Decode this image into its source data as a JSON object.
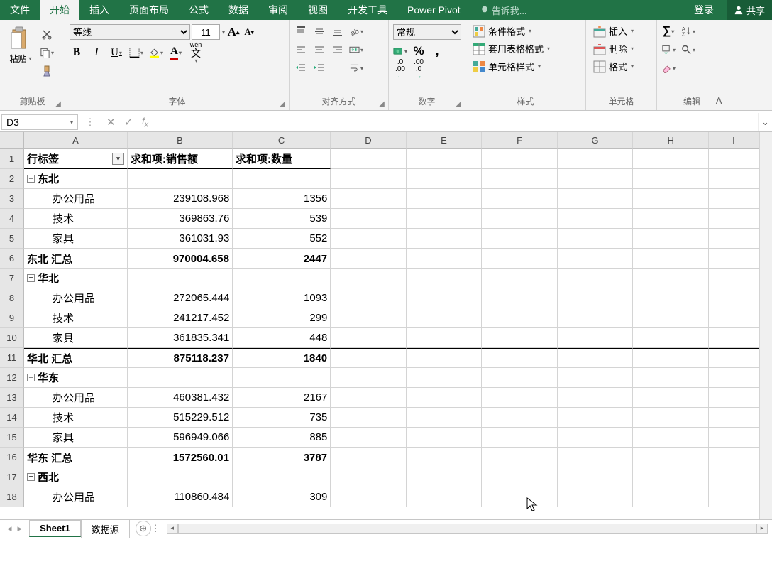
{
  "menu": {
    "file": "文件",
    "home": "开始",
    "insert": "插入",
    "layout": "页面布局",
    "formulas": "公式",
    "data": "数据",
    "review": "审阅",
    "view": "视图",
    "dev": "开发工具",
    "pivot": "Power Pivot",
    "tellme": "告诉我...",
    "login": "登录",
    "share": "共享"
  },
  "ribbon": {
    "clipboard": {
      "paste": "粘贴",
      "label": "剪贴板"
    },
    "font": {
      "name": "等线",
      "size": "11",
      "bold": "B",
      "italic": "I",
      "underline": "U",
      "label": "字体",
      "wen": "wén",
      "wenchar": "文"
    },
    "align": {
      "label": "对齐方式"
    },
    "number": {
      "format": "常规",
      "pct": "%",
      "comma": ",",
      "dec_inc": ".0 .00",
      "label": "数字"
    },
    "styles": {
      "cond": "条件格式",
      "table": "套用表格格式",
      "cell": "单元格样式",
      "label": "样式"
    },
    "cells": {
      "insert": "插入",
      "delete": "删除",
      "format": "格式",
      "label": "单元格"
    },
    "editing": {
      "label": "编辑"
    }
  },
  "fx": {
    "cell_ref": "D3",
    "formula": ""
  },
  "grid": {
    "col_widths": {
      "A": 148,
      "B": 150,
      "C": 140,
      "D": 108,
      "E": 108,
      "F": 108,
      "G": 108,
      "H": 108,
      "I": 72
    },
    "cols": [
      "A",
      "B",
      "C",
      "D",
      "E",
      "F",
      "G",
      "H",
      "I"
    ],
    "row_count": 18,
    "header": [
      "行标签",
      "求和项:销售额",
      "求和项:数量"
    ],
    "rows": [
      {
        "type": "group",
        "a": "东北"
      },
      {
        "type": "item",
        "a": "办公用品",
        "b": "239108.968",
        "c": "1356"
      },
      {
        "type": "item",
        "a": "技术",
        "b": "369863.76",
        "c": "539"
      },
      {
        "type": "item",
        "a": "家具",
        "b": "361031.93",
        "c": "552"
      },
      {
        "type": "total",
        "a": "东北 汇总",
        "b": "970004.658",
        "c": "2447"
      },
      {
        "type": "group",
        "a": "华北"
      },
      {
        "type": "item",
        "a": "办公用品",
        "b": "272065.444",
        "c": "1093"
      },
      {
        "type": "item",
        "a": "技术",
        "b": "241217.452",
        "c": "299"
      },
      {
        "type": "item",
        "a": "家具",
        "b": "361835.341",
        "c": "448"
      },
      {
        "type": "total",
        "a": "华北 汇总",
        "b": "875118.237",
        "c": "1840"
      },
      {
        "type": "group",
        "a": "华东"
      },
      {
        "type": "item",
        "a": "办公用品",
        "b": "460381.432",
        "c": "2167"
      },
      {
        "type": "item",
        "a": "技术",
        "b": "515229.512",
        "c": "735"
      },
      {
        "type": "item",
        "a": "家具",
        "b": "596949.066",
        "c": "885"
      },
      {
        "type": "total",
        "a": "华东 汇总",
        "b": "1572560.01",
        "c": "3787"
      },
      {
        "type": "group",
        "a": "西北"
      },
      {
        "type": "item",
        "a": "办公用品",
        "b": "110860.484",
        "c": "309"
      }
    ]
  },
  "sheets": {
    "active": "Sheet1",
    "other": "数据源"
  }
}
